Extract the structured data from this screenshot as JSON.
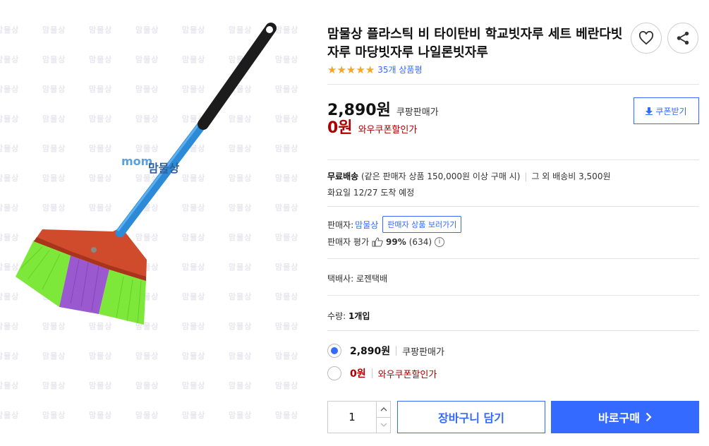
{
  "product": {
    "title": "맘물상 플라스틱 비 타이탄비 학교빗자루 세트 베란다빗자루 마당빗자루 나일론빗자루",
    "review_count": "35개 상품평",
    "rating": 5,
    "image_watermark": "맘물상",
    "image_brand_sub": "mom"
  },
  "price": {
    "sale_price": "2,890원",
    "sale_label": "쿠팡판매가",
    "wow_price": "0원",
    "wow_label": "와우쿠폰할인가",
    "coupon_button": "쿠폰받기"
  },
  "shipping": {
    "free_label": "무료배송",
    "free_condition": "(같은 판매자 상품 150,000원 이상 구매 시)",
    "other_fee": "그 외 배송비 3,500원",
    "arrival": "화요일 12/27 도착 예정"
  },
  "seller": {
    "label": "판매자:",
    "name": "맘물상",
    "link": "판매자 상품 보러가기",
    "rating_label": "판매자 평가",
    "rating_value": "99%",
    "rating_count": "(634)"
  },
  "courier": "택배사: 로젠택배",
  "quantity": {
    "label": "수량:",
    "value_text": "1개입",
    "input_value": "1"
  },
  "options": [
    {
      "price": "2,890원",
      "label": "쿠팡판매가",
      "selected": true
    },
    {
      "price": "0원",
      "label": "와우쿠폰할인가",
      "selected": false
    }
  ],
  "actions": {
    "cart": "장바구니 담기",
    "buy": "바로구매"
  },
  "colors": {
    "accent": "#346aff",
    "discount_red": "#ae0000",
    "star": "#f5a623"
  }
}
